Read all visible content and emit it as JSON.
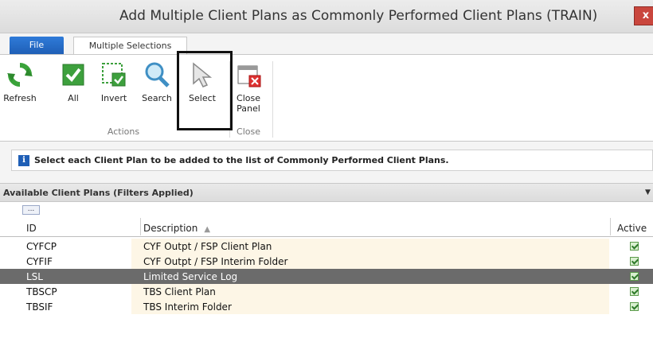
{
  "window": {
    "title": "Add Multiple Client Plans as Commonly Performed Client Plans (TRAIN)",
    "close_label": "x"
  },
  "tabs": {
    "file": "File",
    "multiple_selections": "Multiple Selections"
  },
  "ribbon": {
    "buttons": [
      {
        "label": "Refresh",
        "icon": "refresh-icon"
      },
      {
        "label": "All",
        "icon": "check-all-icon"
      },
      {
        "label": "Invert",
        "icon": "invert-selection-icon"
      },
      {
        "label": "Search",
        "icon": "search-icon"
      },
      {
        "label": "Select",
        "icon": "cursor-arrow-icon"
      },
      {
        "label": "Close\nPanel",
        "icon": "close-panel-icon"
      }
    ],
    "groups": {
      "actions": "Actions",
      "close": "Close"
    }
  },
  "info": {
    "text": "Select each Client Plan to be added to the list of Commonly Performed Client Plans."
  },
  "panel": {
    "title": "Available Client Plans (Filters Applied)",
    "options_label": "..."
  },
  "table": {
    "columns": [
      "ID",
      "Description",
      "Active"
    ],
    "rows": [
      {
        "id": "CYFCP",
        "description": "CYF Outpt / FSP Client Plan",
        "active": true,
        "selected": false
      },
      {
        "id": "CYFIF",
        "description": "CYF Outpt / FSP Interim Folder",
        "active": true,
        "selected": false
      },
      {
        "id": "LSL",
        "description": "Limited Service Log",
        "active": true,
        "selected": true
      },
      {
        "id": "TBSCP",
        "description": "TBS Client Plan",
        "active": true,
        "selected": false
      },
      {
        "id": "TBSIF",
        "description": "TBS Interim Folder",
        "active": true,
        "selected": false
      }
    ]
  },
  "colors": {
    "accent_blue": "#1f5fb6",
    "selected_row": "#6b6b6b",
    "close_red": "#c9463d"
  }
}
